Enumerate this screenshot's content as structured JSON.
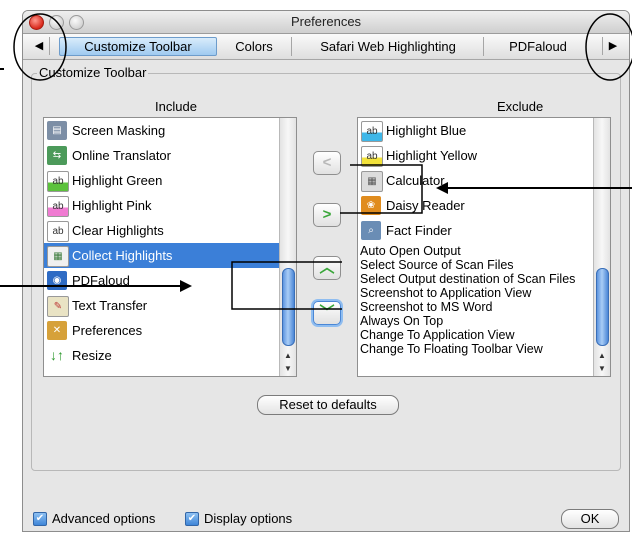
{
  "window": {
    "title": "Preferences"
  },
  "tabs": {
    "items": [
      {
        "label": "Customize Toolbar",
        "active": true
      },
      {
        "label": "Colors",
        "active": false
      },
      {
        "label": "Safari Web Highlighting",
        "active": false
      },
      {
        "label": "PDFaloud",
        "active": false
      }
    ]
  },
  "panel": {
    "group_label": "Customize Toolbar",
    "include_header": "Include",
    "exclude_header": "Exclude",
    "include_items": [
      {
        "label": "Screen Masking",
        "icon": "screen-masking-icon"
      },
      {
        "label": "Online Translator",
        "icon": "translator-icon"
      },
      {
        "label": "Highlight Green",
        "icon": "highlighter-green-icon"
      },
      {
        "label": "Highlight Pink",
        "icon": "highlighter-pink-icon"
      },
      {
        "label": "Clear Highlights",
        "icon": "clear-highlights-icon"
      },
      {
        "label": "Collect Highlights",
        "icon": "collect-highlights-icon",
        "selected": true
      },
      {
        "label": "PDFaloud",
        "icon": "pdfaloud-icon"
      },
      {
        "label": "Text Transfer",
        "icon": "text-transfer-icon"
      },
      {
        "label": "Preferences",
        "icon": "preferences-tools-icon"
      },
      {
        "label": "Resize",
        "icon": "resize-arrows-icon"
      }
    ],
    "exclude_icon_items": [
      {
        "label": "Highlight Blue",
        "icon": "highlighter-blue-icon"
      },
      {
        "label": "Highlight Yellow",
        "icon": "highlighter-yellow-icon"
      },
      {
        "label": "Calculator",
        "icon": "calculator-icon"
      },
      {
        "label": "Daisy Reader",
        "icon": "daisy-reader-icon"
      },
      {
        "label": "Fact Finder",
        "icon": "fact-finder-icon"
      }
    ],
    "exclude_text_items": [
      "Auto Open Output",
      "Select Source of Scan Files",
      "Select Output destination of Scan Files",
      "Screenshot to Application View",
      "Screenshot to MS Word",
      "Always On Top",
      "Change To Application View",
      "Change To Floating Toolbar View"
    ],
    "reset_label": "Reset to defaults"
  },
  "footer": {
    "advanced_label": "Advanced options",
    "advanced_checked": true,
    "display_label": "Display options",
    "display_checked": true,
    "ok_label": "OK"
  },
  "colors": {
    "selection": "#3b7fd8",
    "move_arrow": "#3aa63a",
    "up_down_arrow": "#3aa63a"
  }
}
